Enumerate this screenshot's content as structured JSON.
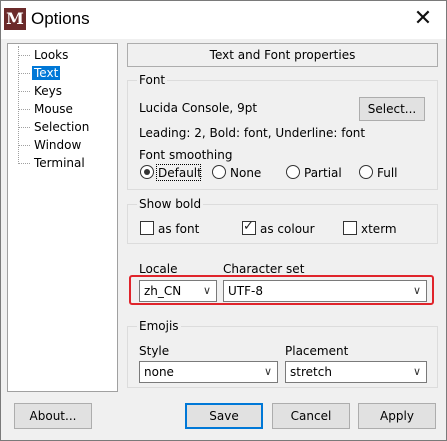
{
  "window": {
    "title": "Options",
    "app_icon": "M",
    "close_glyph": "✕"
  },
  "tree": {
    "items": [
      "Looks",
      "Text",
      "Keys",
      "Mouse",
      "Selection",
      "Window",
      "Terminal"
    ],
    "selected": "Text"
  },
  "panel": {
    "header": "Text and Font properties"
  },
  "font": {
    "group_label": "Font",
    "name": "Lucida Console, 9pt",
    "select_label": "Select...",
    "details": "Leading: 2, Bold: font, Underline: font",
    "smoothing_label": "Font smoothing",
    "smoothing_options": [
      "Default",
      "None",
      "Partial",
      "Full"
    ],
    "smoothing_selected": "Default"
  },
  "show_bold": {
    "group_label": "Show bold",
    "options": [
      {
        "label": "as font",
        "checked": false
      },
      {
        "label": "as colour",
        "checked": true
      },
      {
        "label": "xterm",
        "checked": false
      }
    ]
  },
  "locale": {
    "label": "Locale",
    "value": "zh_CN"
  },
  "charset": {
    "label": "Character set",
    "value": "UTF-8"
  },
  "emojis": {
    "group_label": "Emojis",
    "style_label": "Style",
    "style_value": "none",
    "placement_label": "Placement",
    "placement_value": "stretch"
  },
  "buttons": {
    "about": "About...",
    "save": "Save",
    "cancel": "Cancel",
    "apply": "Apply"
  },
  "colors": {
    "selection": "#0078d7",
    "highlight": "#e0242b"
  }
}
